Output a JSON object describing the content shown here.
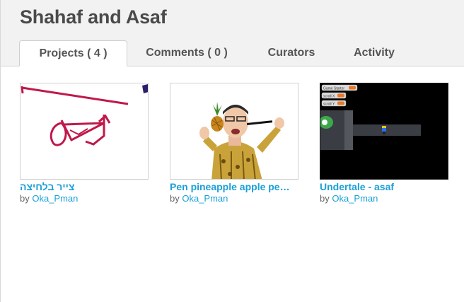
{
  "studio": {
    "title": "Shahaf and Asaf"
  },
  "tabs": [
    {
      "label": "Projects ( 4 )",
      "active": true
    },
    {
      "label": "Comments ( 0 )",
      "active": false
    },
    {
      "label": "Curators",
      "active": false
    },
    {
      "label": "Activity",
      "active": false
    }
  ],
  "projects": [
    {
      "title": "צייר בלחיצה",
      "by": "by",
      "author": "Oka_Pman"
    },
    {
      "title": "Pen pineapple apple pe…",
      "by": "by",
      "author": "Oka_Pman"
    },
    {
      "title": "Undertale - asaf",
      "by": "by",
      "author": "Oka_Pman"
    }
  ],
  "thumb3_blocks": [
    "Game Starter",
    "scroll X",
    "scroll Y"
  ],
  "colors": {
    "link": "#1aa0d8",
    "title": "#4a4a4a",
    "header_bg": "#f2f2f2"
  }
}
